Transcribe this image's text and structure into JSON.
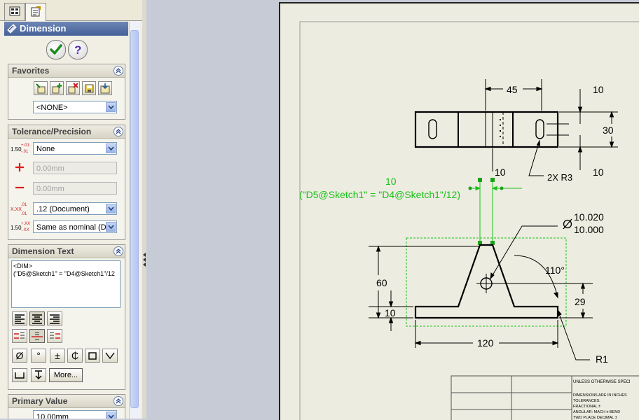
{
  "property_manager": {
    "title": "Dimension",
    "favorites": {
      "header": "Favorites",
      "style": "<NONE>"
    },
    "tolerance": {
      "header": "Tolerance/Precision",
      "type": "None",
      "plus": "0.00mm",
      "minus": "0.00mm",
      "precision": ".12 (Document)",
      "tol_precision": "Same as nominal (D",
      "icon_text_a": "1.50",
      "icon_text_b": "+.01",
      "icon_text_c": "-.01",
      "icon_text_d": "X.XX",
      "icon_text_e": ".01",
      "icon_text_f": "+.XX",
      "icon_text_g": "-.XX"
    },
    "dimension_text": {
      "header": "Dimension Text",
      "line1": "<DIM>",
      "line2": "(\"D5@Sketch1\" = \"D4@Sketch1\"/12",
      "symbols": [
        "Ø",
        "°",
        "±",
        "₵"
      ],
      "more": "More..."
    },
    "primary_value": {
      "header": "Primary Value",
      "value": "10.00mm"
    }
  },
  "drawing": {
    "dim_45": "45",
    "dim_10_top": "10",
    "dim_30": "30",
    "dim_10_right": "10",
    "dim_10_mid": "10",
    "note_2x_r3": "2X R3",
    "selected_dim_value": "10",
    "selected_dim_equation": "(\"D5@Sketch1\" = \"D4@Sketch1\"/12)",
    "dia_upper": "10.020",
    "dia_lower": "10.000",
    "angle": "110°",
    "dim_60": "60",
    "dim_29": "29",
    "dim_10_base": "10",
    "dim_120": "120",
    "note_r1": "R1",
    "title_block": {
      "line1": "UNLESS OTHERWISE SPECI",
      "line2": "DIMENSIONS ARE IN INCHES",
      "line3": "TOLERANCES:",
      "line4": "FRACTIONAL ±",
      "line5": "ANGULAR: MACH ±    BEND",
      "line6": "TWO PLACE DECIMAL ±"
    }
  },
  "colors": {
    "selected": "#19c219",
    "handle": "#1aa21a",
    "line": "#000000"
  }
}
